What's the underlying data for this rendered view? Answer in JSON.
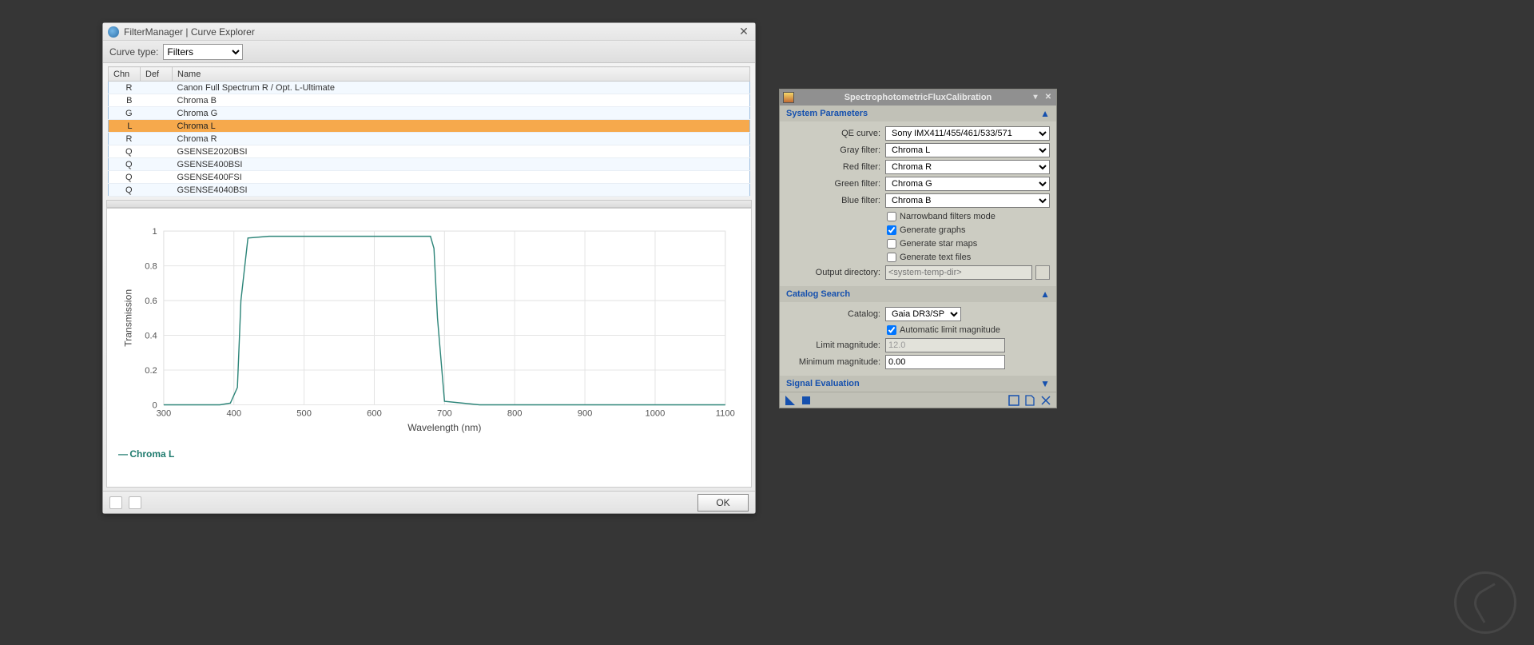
{
  "fm": {
    "title": "FilterManager | Curve Explorer",
    "curve_type_label": "Curve type:",
    "curve_type_value": "Filters",
    "columns": {
      "chn": "Chn",
      "def": "Def",
      "name": "Name"
    },
    "rows": [
      {
        "chn": "R",
        "def": "",
        "name": "Canon Full Spectrum R / Opt. L-Ultimate"
      },
      {
        "chn": "B",
        "def": "",
        "name": "Chroma B"
      },
      {
        "chn": "G",
        "def": "",
        "name": "Chroma G"
      },
      {
        "chn": "L",
        "def": "",
        "name": "Chroma L",
        "selected": true
      },
      {
        "chn": "R",
        "def": "",
        "name": "Chroma R"
      },
      {
        "chn": "Q",
        "def": "",
        "name": "GSENSE2020BSI"
      },
      {
        "chn": "Q",
        "def": "",
        "name": "GSENSE400BSI"
      },
      {
        "chn": "Q",
        "def": "",
        "name": "GSENSE400FSI"
      },
      {
        "chn": "Q",
        "def": "",
        "name": "GSENSE4040BSI"
      }
    ],
    "legend": "Chroma L",
    "xlabel": "Wavelength (nm)",
    "ylabel": "Transmission",
    "ok_label": "OK"
  },
  "pix": {
    "title": "SpectrophotometricFluxCalibration",
    "sections": {
      "sys": "System Parameters",
      "catalog": "Catalog Search",
      "sigeval": "Signal Evaluation"
    },
    "labels": {
      "qe": "QE curve:",
      "gray": "Gray filter:",
      "red": "Red filter:",
      "green": "Green filter:",
      "blue": "Blue filter:",
      "outdir": "Output directory:",
      "catalog": "Catalog:",
      "limmag": "Limit magnitude:",
      "minmag": "Minimum magnitude:"
    },
    "values": {
      "qe": "Sony IMX411/455/461/533/571",
      "gray": "Chroma L",
      "red": "Chroma R",
      "green": "Chroma G",
      "blue": "Chroma B",
      "outdir_placeholder": "<system-temp-dir>",
      "catalog": "Gaia DR3/SP",
      "limmag": "12.0",
      "minmag": "0.00"
    },
    "checks": {
      "narrowband": "Narrowband filters mode",
      "graphs": "Generate graphs",
      "starmaps": "Generate star maps",
      "textfiles": "Generate text files",
      "autolim": "Automatic limit magnitude"
    }
  },
  "chart_data": {
    "type": "line",
    "title": "",
    "xlabel": "Wavelength (nm)",
    "ylabel": "Transmission",
    "xlim": [
      300,
      1100
    ],
    "ylim": [
      0,
      1
    ],
    "xticks": [
      300,
      400,
      500,
      600,
      700,
      800,
      900,
      1000,
      1100
    ],
    "yticks": [
      0,
      0.2,
      0.4,
      0.6,
      0.8,
      1
    ],
    "series": [
      {
        "name": "Chroma L",
        "color": "#2d8579",
        "x": [
          300,
          380,
          395,
          405,
          410,
          420,
          450,
          500,
          550,
          600,
          650,
          680,
          685,
          690,
          700,
          750,
          800,
          1100
        ],
        "y": [
          0.0,
          0.0,
          0.01,
          0.1,
          0.6,
          0.96,
          0.97,
          0.97,
          0.97,
          0.97,
          0.97,
          0.97,
          0.9,
          0.5,
          0.02,
          0.0,
          0.0,
          0.0
        ]
      }
    ]
  }
}
